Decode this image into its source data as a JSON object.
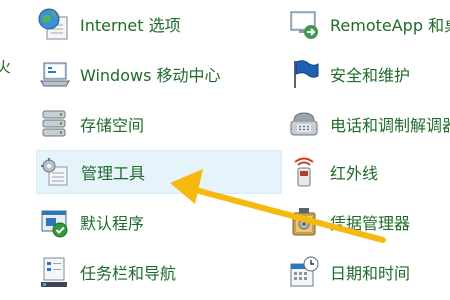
{
  "edge_text": "火",
  "left_items": [
    {
      "label": "Internet 选项",
      "icon": "internet-options-icon"
    },
    {
      "label": "Windows 移动中心",
      "icon": "mobility-center-icon"
    },
    {
      "label": "存储空间",
      "icon": "storage-spaces-icon"
    },
    {
      "label": "管理工具",
      "icon": "administrative-tools-icon",
      "selected": true
    },
    {
      "label": "默认程序",
      "icon": "default-programs-icon"
    },
    {
      "label": "任务栏和导航",
      "icon": "taskbar-navigation-icon"
    }
  ],
  "right_items": [
    {
      "label": "RemoteApp 和桌",
      "icon": "remoteapp-icon"
    },
    {
      "label": "安全和维护",
      "icon": "security-maintenance-flag-icon"
    },
    {
      "label": "电话和调制解调器",
      "icon": "phone-modem-icon"
    },
    {
      "label": "红外线",
      "icon": "infrared-icon"
    },
    {
      "label": "凭据管理器",
      "icon": "credential-manager-icon"
    },
    {
      "label": "日期和时间",
      "icon": "date-time-icon"
    }
  ],
  "colors": {
    "link_text": "#1e6b2a",
    "selection_bg": "#e5f3fb",
    "arrow": "#f6b910"
  }
}
